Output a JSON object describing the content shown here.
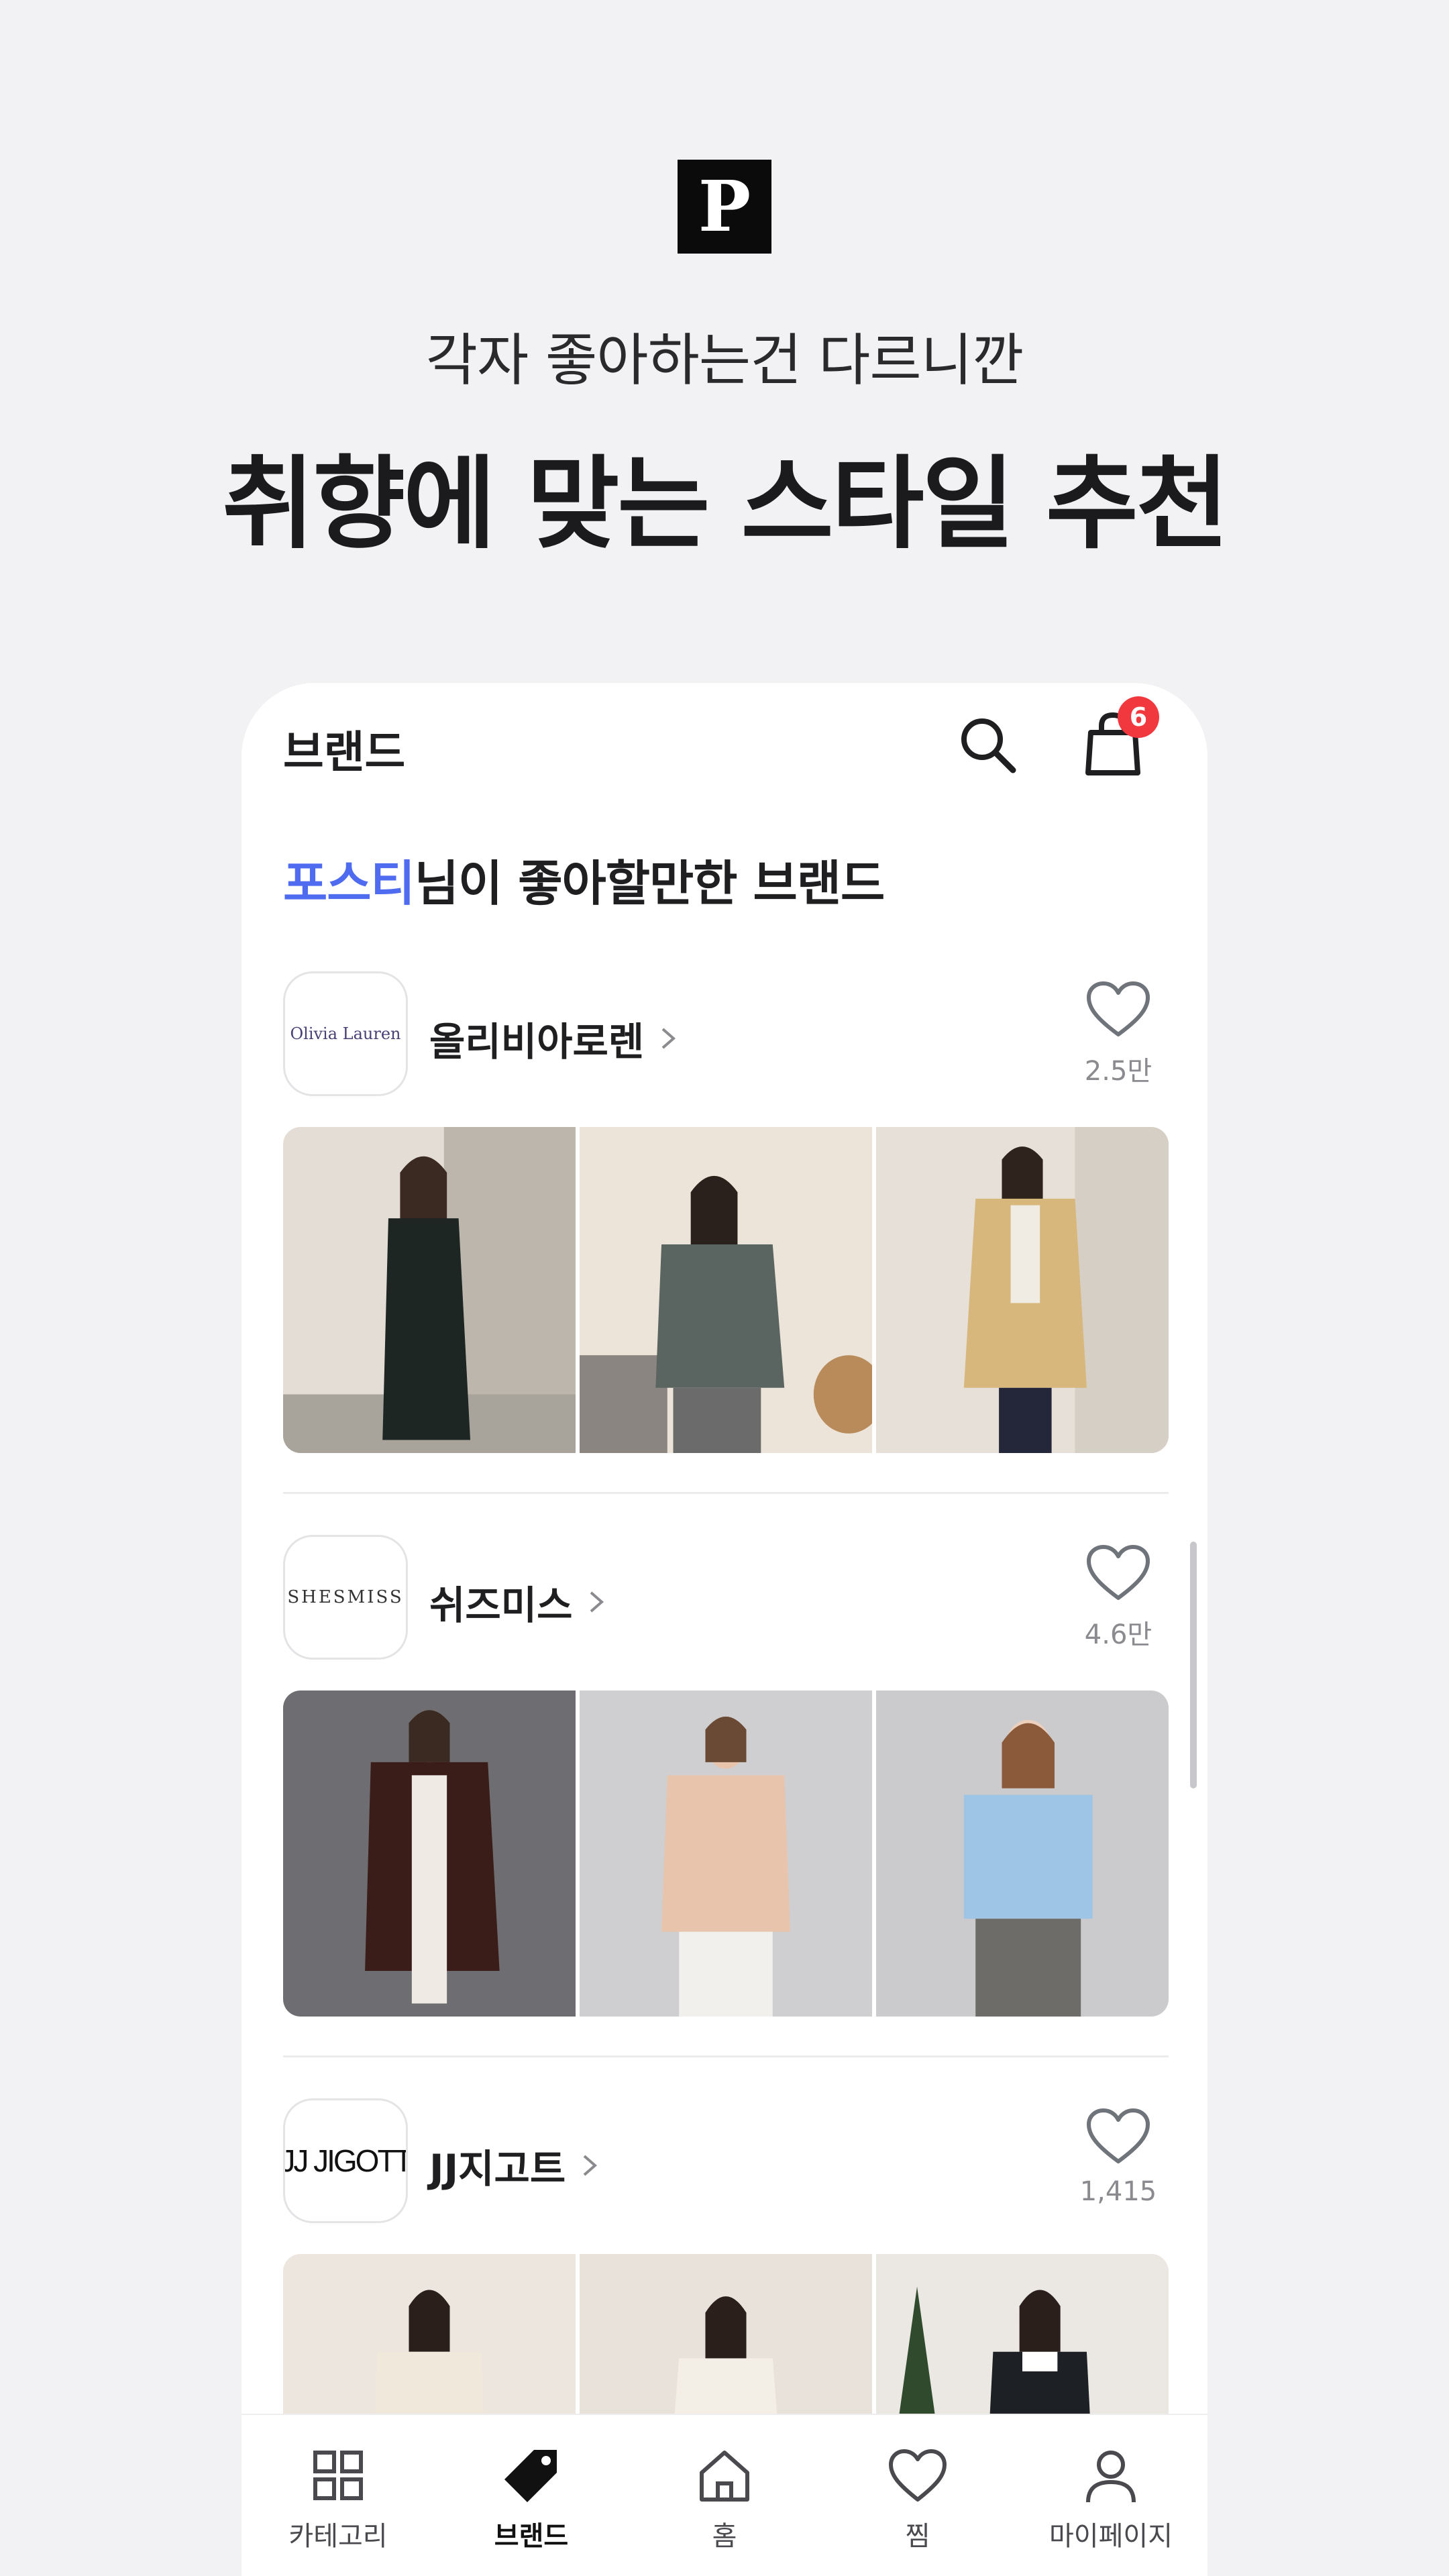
{
  "promo": {
    "logo_letter": "P",
    "tagline": "각자 좋아하는건 다르니깐",
    "headline": "취향에 맞는 스타일 추천"
  },
  "header": {
    "title": "브랜드",
    "cart_badge": "6",
    "icons": [
      "search-icon",
      "shopping-bag-icon"
    ]
  },
  "section": {
    "user_name": "포스티",
    "title_rest": "님이 좋아할만한 브랜드"
  },
  "brands": [
    {
      "logo_text": "Olivia Lauren",
      "name": "올리비아로렌",
      "likes": "2.5만"
    },
    {
      "logo_text": "SHESMISS",
      "name": "쉬즈미스",
      "likes": "4.6만"
    },
    {
      "logo_text": "JJ JIGOTT",
      "name": "JJ지고트",
      "likes": "1,415"
    }
  ],
  "bottom_nav": {
    "items": [
      {
        "label": "카테고리",
        "icon": "grid-icon"
      },
      {
        "label": "브랜드",
        "icon": "tag-icon"
      },
      {
        "label": "홈",
        "icon": "home-icon"
      },
      {
        "label": "찜",
        "icon": "heart-icon"
      },
      {
        "label": "마이페이지",
        "icon": "person-icon"
      }
    ],
    "active": "브랜드"
  },
  "colors": {
    "accent_user": "#4f6cf0",
    "badge": "#f2383f",
    "background": "#f2f2f4"
  }
}
